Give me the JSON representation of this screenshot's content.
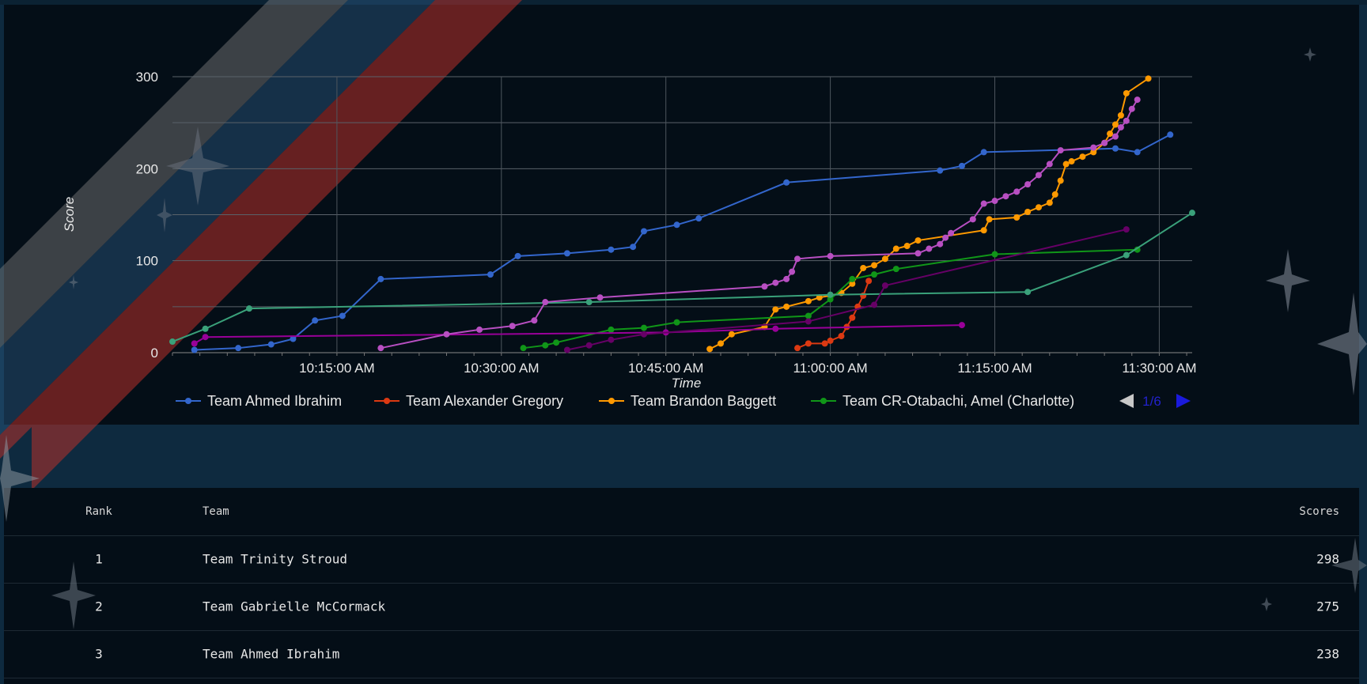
{
  "chart_data": {
    "type": "line",
    "title": "",
    "xlabel": "Time",
    "ylabel": "Score",
    "ylim": [
      0,
      300
    ],
    "yticks": [
      "0",
      "100",
      "200",
      "300"
    ],
    "xrange": [
      "10:00",
      "11:33"
    ],
    "xticks": [
      "10:15:00 AM",
      "10:30:00 AM",
      "10:45:00 AM",
      "11:00:00 AM",
      "11:15:00 AM",
      "11:30:00 AM"
    ],
    "legend_position": "bottom",
    "pagination": "1/6",
    "series": [
      {
        "name": "Team Ahmed Ibrahim",
        "color": "#3366cc",
        "points": [
          [
            "10:02",
            3
          ],
          [
            "10:06",
            5
          ],
          [
            "10:09",
            9
          ],
          [
            "10:11",
            15
          ],
          [
            "10:13",
            35
          ],
          [
            "10:15:30",
            40
          ],
          [
            "10:19",
            80
          ],
          [
            "10:29",
            85
          ],
          [
            "10:31:30",
            105
          ],
          [
            "10:36",
            108
          ],
          [
            "10:40",
            112
          ],
          [
            "10:42",
            115
          ],
          [
            "10:43",
            132
          ],
          [
            "10:46",
            139
          ],
          [
            "10:48",
            146
          ],
          [
            "10:56",
            185
          ],
          [
            "11:10",
            198
          ],
          [
            "11:12",
            203
          ],
          [
            "11:14",
            218
          ],
          [
            "11:26",
            222
          ],
          [
            "11:28",
            218
          ],
          [
            "11:31",
            237
          ]
        ]
      },
      {
        "name": "Team Alexander Gregory",
        "color": "#dc3912",
        "points": [
          [
            "10:57",
            5
          ],
          [
            "10:58",
            10
          ],
          [
            "10:59:30",
            10
          ],
          [
            "11:00",
            13
          ],
          [
            "11:01",
            18
          ],
          [
            "11:01:30",
            28
          ],
          [
            "11:02",
            38
          ],
          [
            "11:02:30",
            50
          ],
          [
            "11:03",
            62
          ],
          [
            "11:03:30",
            78
          ]
        ]
      },
      {
        "name": "Team Brandon Baggett",
        "color": "#ff9900",
        "points": [
          [
            "10:49",
            4
          ],
          [
            "10:50",
            10
          ],
          [
            "10:51",
            20
          ],
          [
            "10:54",
            28
          ],
          [
            "10:55",
            47
          ],
          [
            "10:56",
            50
          ],
          [
            "10:58",
            56
          ],
          [
            "10:59",
            60
          ],
          [
            "11:00",
            62
          ],
          [
            "11:01",
            65
          ],
          [
            "11:02",
            75
          ],
          [
            "11:03",
            92
          ],
          [
            "11:04",
            95
          ],
          [
            "11:05",
            102
          ],
          [
            "11:06",
            113
          ],
          [
            "11:07",
            116
          ],
          [
            "11:08",
            122
          ],
          [
            "11:14",
            133
          ],
          [
            "11:14:30",
            145
          ],
          [
            "11:17",
            147
          ],
          [
            "11:18",
            153
          ],
          [
            "11:19",
            158
          ],
          [
            "11:20",
            163
          ],
          [
            "11:20:30",
            172
          ],
          [
            "11:21",
            187
          ],
          [
            "11:21:30",
            205
          ],
          [
            "11:22",
            208
          ],
          [
            "11:23",
            213
          ],
          [
            "11:24",
            218
          ],
          [
            "11:25",
            228
          ],
          [
            "11:25:30",
            238
          ],
          [
            "11:26",
            248
          ],
          [
            "11:26:30",
            258
          ],
          [
            "11:27",
            282
          ],
          [
            "11:29",
            298
          ]
        ]
      },
      {
        "name": "Team CR-Otabachi, Amel (Charlotte)",
        "color": "#109618",
        "points": [
          [
            "10:32",
            5
          ],
          [
            "10:34",
            8
          ],
          [
            "10:35",
            11
          ],
          [
            "10:40",
            25
          ],
          [
            "10:43",
            27
          ],
          [
            "10:46",
            33
          ],
          [
            "10:58",
            40
          ],
          [
            "11:00",
            58
          ],
          [
            "11:02",
            80
          ],
          [
            "11:04",
            85
          ],
          [
            "11:06",
            91
          ],
          [
            "11:15",
            107
          ],
          [
            "11:28",
            112
          ]
        ]
      },
      {
        "name": "",
        "color": "#990099",
        "points": [
          [
            "10:02",
            10
          ],
          [
            "10:03",
            17
          ],
          [
            "10:45",
            22
          ],
          [
            "10:55",
            26
          ],
          [
            "11:12",
            30
          ]
        ]
      },
      {
        "name": "",
        "color": "#3aa17a",
        "points": [
          [
            "10:00",
            12
          ],
          [
            "10:03",
            26
          ],
          [
            "10:07",
            48
          ],
          [
            "10:38",
            55
          ],
          [
            "11:00",
            63
          ],
          [
            "11:18",
            66
          ],
          [
            "11:27",
            106
          ],
          [
            "11:33",
            152
          ]
        ]
      },
      {
        "name": "",
        "color": "#b84fc2",
        "points": [
          [
            "10:19",
            5
          ],
          [
            "10:25",
            20
          ],
          [
            "10:28",
            25
          ],
          [
            "10:31",
            29
          ],
          [
            "10:33",
            35
          ],
          [
            "10:34",
            55
          ],
          [
            "10:39",
            60
          ],
          [
            "10:54",
            72
          ],
          [
            "10:55",
            76
          ],
          [
            "10:56",
            80
          ],
          [
            "10:56:30",
            88
          ],
          [
            "10:57",
            102
          ],
          [
            "11:00",
            105
          ],
          [
            "11:08",
            108
          ],
          [
            "11:09",
            113
          ],
          [
            "11:10",
            118
          ],
          [
            "11:10:30",
            125
          ],
          [
            "11:11",
            130
          ],
          [
            "11:13",
            145
          ],
          [
            "11:14",
            162
          ],
          [
            "11:15",
            165
          ],
          [
            "11:16",
            170
          ],
          [
            "11:17",
            175
          ],
          [
            "11:18",
            183
          ],
          [
            "11:19",
            193
          ],
          [
            "11:20",
            205
          ],
          [
            "11:21",
            220
          ],
          [
            "11:24",
            223
          ],
          [
            "11:25",
            228
          ],
          [
            "11:26",
            235
          ],
          [
            "11:26:30",
            245
          ],
          [
            "11:27",
            252
          ],
          [
            "11:27:30",
            265
          ],
          [
            "11:28",
            275
          ]
        ]
      },
      {
        "name": "",
        "color": "#660066",
        "points": [
          [
            "10:36",
            3
          ],
          [
            "10:38",
            8
          ],
          [
            "10:40",
            14
          ],
          [
            "10:43",
            20
          ],
          [
            "10:58",
            34
          ],
          [
            "11:04",
            52
          ],
          [
            "11:05",
            73
          ],
          [
            "11:27",
            134
          ]
        ]
      }
    ]
  },
  "leaderboard": {
    "headers": {
      "rank": "Rank",
      "team": "Team",
      "score": "Scores"
    },
    "rows": [
      {
        "rank": "1",
        "team": "Team Trinity Stroud",
        "score": "298"
      },
      {
        "rank": "2",
        "team": "Team Gabrielle McCormack",
        "score": "275"
      },
      {
        "rank": "3",
        "team": "Team Ahmed Ibrahim",
        "score": "238"
      }
    ]
  }
}
